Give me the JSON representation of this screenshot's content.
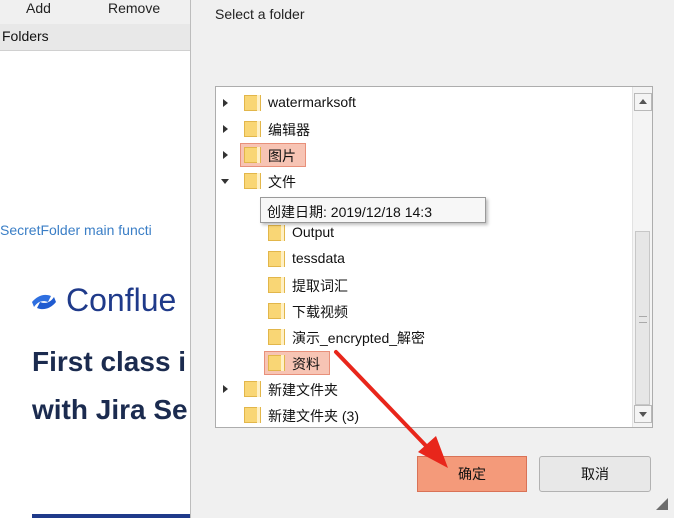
{
  "background_app": {
    "toolbar": {
      "add_label": "Add",
      "remove_label": "Remove"
    },
    "folders_header": "Folders",
    "link_text": "SecretFolder main functi",
    "ad": {
      "logo_text": "Conflue",
      "headline_line1": "First class i",
      "headline_line2": "with Jira Se",
      "brand_color": "#1f3a8a"
    }
  },
  "dialog": {
    "title": "Select a folder",
    "tree_items": [
      {
        "label": "watermarksoft",
        "expander": "collapsed"
      },
      {
        "label": "编辑器",
        "expander": "collapsed"
      },
      {
        "label": "图片",
        "expander": "collapsed",
        "highlighted": true
      },
      {
        "label": "文件",
        "expander": "expanded"
      },
      {
        "label": "Output",
        "expander": "none"
      },
      {
        "label": "tessdata",
        "expander": "none"
      },
      {
        "label": "提取词汇",
        "expander": "none"
      },
      {
        "label": "下载视频",
        "expander": "none"
      },
      {
        "label": "演示_encrypted_解密",
        "expander": "none"
      },
      {
        "label": "资料",
        "expander": "none",
        "highlighted": true
      },
      {
        "label": "新建文件夹",
        "expander": "collapsed"
      },
      {
        "label": "新建文件夹 (3)",
        "expander": "none"
      }
    ],
    "tooltip": "创建日期: 2019/12/18 14:3",
    "ok_label": "确定",
    "cancel_label": "取消",
    "colors": {
      "highlight_fill": "#f7c4b4",
      "ok_button": "#f49a7a",
      "annotation_arrow": "#e8261b",
      "folder_icon": "#f9d675"
    }
  }
}
